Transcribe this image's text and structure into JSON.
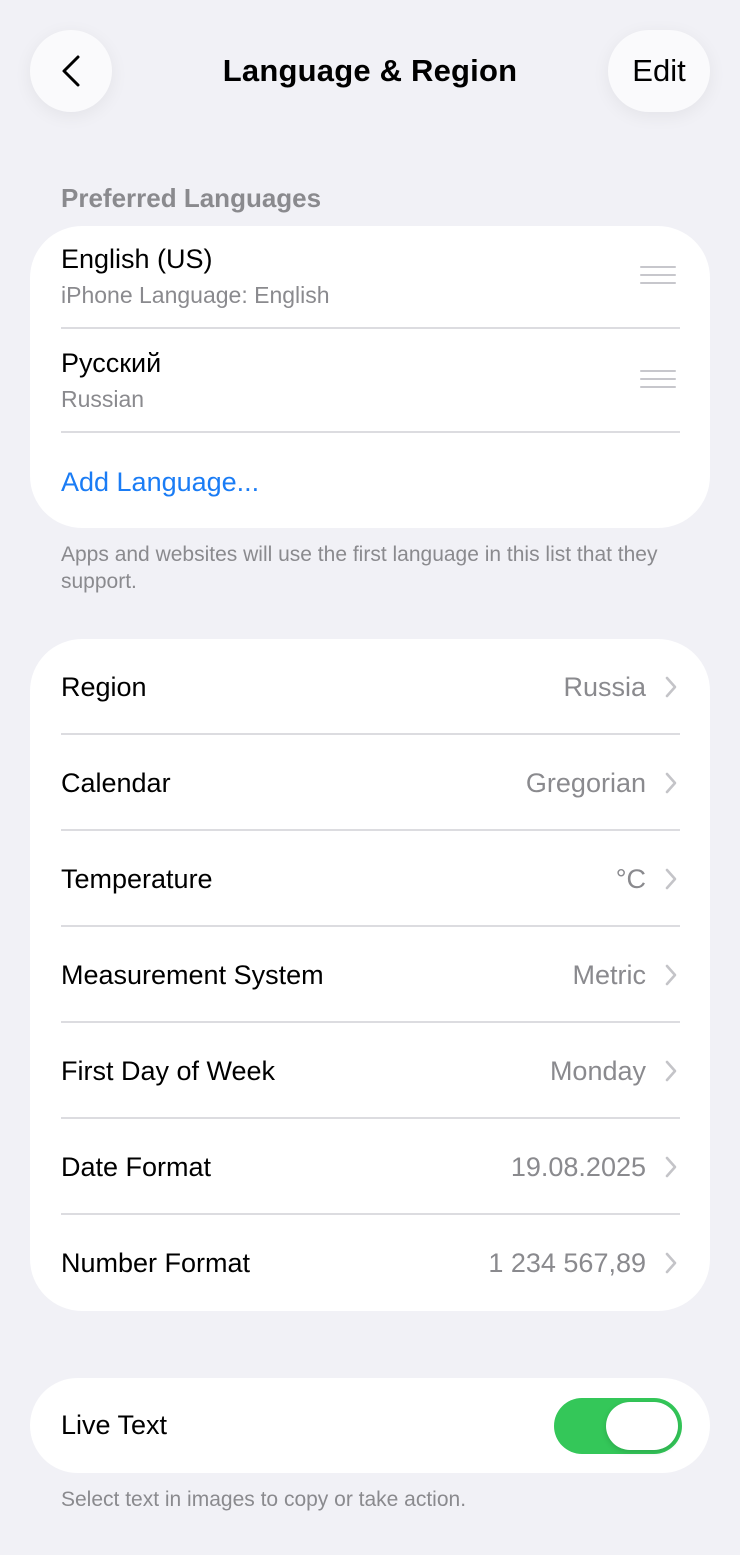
{
  "nav": {
    "title": "Language & Region",
    "edit_label": "Edit",
    "back_icon": "chevron-left-icon"
  },
  "languages": {
    "header": "Preferred Languages",
    "items": [
      {
        "name": "English (US)",
        "subtitle": "iPhone Language: English"
      },
      {
        "name": "Русский",
        "subtitle": "Russian"
      }
    ],
    "add_label": "Add Language...",
    "footnote": "Apps and websites will use the first language in this list that they support."
  },
  "region_settings": {
    "items": [
      {
        "label": "Region",
        "value": "Russia"
      },
      {
        "label": "Calendar",
        "value": "Gregorian"
      },
      {
        "label": "Temperature",
        "value": "°C"
      },
      {
        "label": "Measurement System",
        "value": "Metric"
      },
      {
        "label": "First Day of Week",
        "value": "Monday"
      },
      {
        "label": "Date Format",
        "value": "19.08.2025"
      },
      {
        "label": "Number Format",
        "value": "1 234 567,89"
      }
    ]
  },
  "live_text": {
    "label": "Live Text",
    "enabled": true,
    "footnote": "Select text in images to copy or take action."
  },
  "colors": {
    "accent_blue": "#1a7cf5",
    "toggle_green": "#34c759",
    "background": "#f1f1f6"
  }
}
